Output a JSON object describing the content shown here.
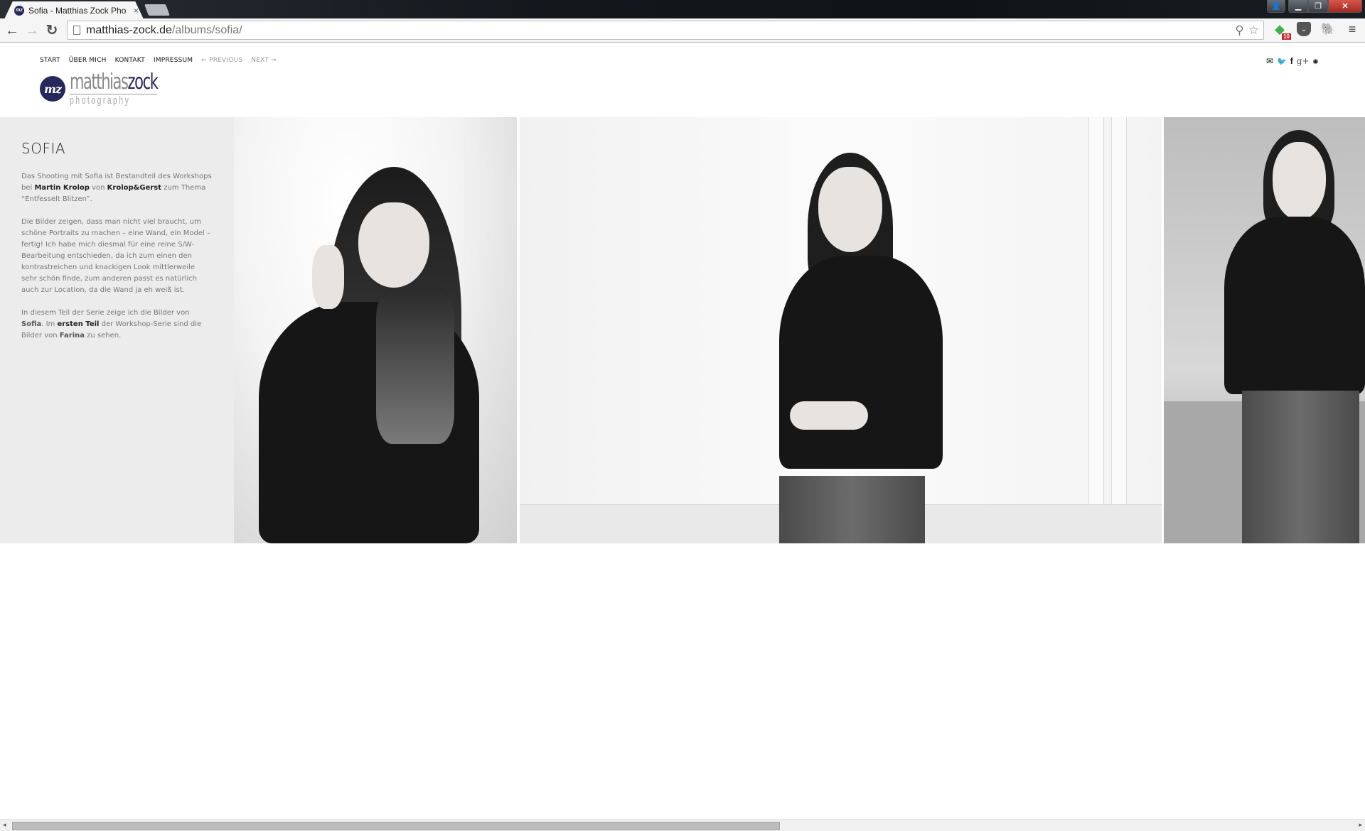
{
  "browser": {
    "tab_title": "Sofia - Matthias Zock Pho",
    "tab_close": "×",
    "favicon_text": "mz",
    "url_host": "matthias-zock.de",
    "url_path": "/albums/sofia/",
    "icons": {
      "back": "←",
      "forward": "→",
      "reload": "↻",
      "search": "⚲",
      "star": "☆",
      "feedly": "◆",
      "feedly_badge": "10",
      "pocket": "⌄",
      "evernote": "🐘",
      "menu": "≡",
      "user": "👤",
      "minimize": "▁",
      "maximize": "❐",
      "close": "✕"
    }
  },
  "site": {
    "nav": [
      {
        "label": "START"
      },
      {
        "label": "ÜBER MICH"
      },
      {
        "label": "KONTAKT"
      },
      {
        "label": "IMPRESSUM"
      },
      {
        "label": "← PREVIOUS"
      },
      {
        "label": "NEXT →"
      }
    ],
    "logo": {
      "mark": "mz",
      "name_light": "matthias",
      "name_bold": "zock",
      "sub": "photography"
    },
    "social": {
      "mail": "✉",
      "twitter": "🐦",
      "facebook": "f",
      "googleplus": "g+",
      "rss": "◉"
    }
  },
  "album": {
    "title": "SOFIA",
    "para1": {
      "t1": "Das Shooting mit Sofia ist Bestandteil des Workshops bei ",
      "b1": "Martin Krolop",
      "t2": " von ",
      "b2": "Krolop&Gerst",
      "t3": " zum Thema “Entfesselt Blitzen”."
    },
    "para2": "Die Bilder zeigen, dass man nicht viel braucht, um schöne Portraits zu machen – eine Wand, ein Model – fertig! Ich habe mich diesmal für eine reine S/W-Bearbeitung entschieden, da ich zum einen den kontrastreichen und knackigen Look mittlerweile sehr schön finde, zum anderen passt es natürlich auch zur Location, da die Wand ja eh weiß ist.",
    "para3": {
      "t1": "In diesem Teil der Serie zeige ich die Bilder von ",
      "b1": "Sofia",
      "t2": ". Im ",
      "b2": "ersten Teil",
      "t3": " der Workshop-Serie sind die Bilder von ",
      "b3": "Farina",
      "t4": " zu sehen."
    },
    "photos": [
      {
        "alt": "Sofia smiling, looking down, hand in hair"
      },
      {
        "alt": "Sofia standing against white wall, arms crossed"
      },
      {
        "alt": "Sofia leaning against wall, hand at neck"
      }
    ]
  },
  "scrollbar": {
    "left_arrow": "◂",
    "right_arrow": "▸"
  }
}
